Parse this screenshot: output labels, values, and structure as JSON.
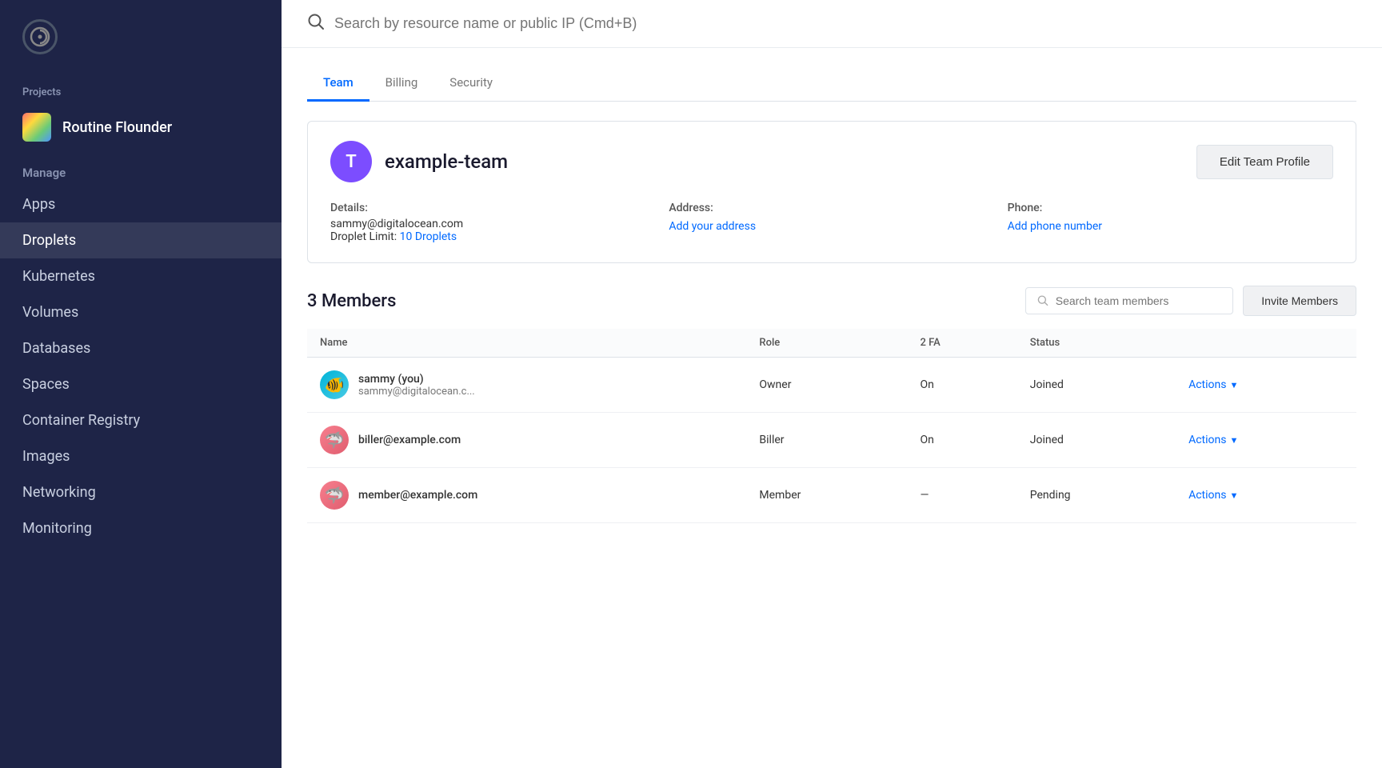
{
  "sidebar": {
    "logo_alt": "DigitalOcean",
    "projects_label": "Projects",
    "project_name": "Routine Flounder",
    "manage_label": "Manage",
    "items": [
      {
        "id": "apps",
        "label": "Apps"
      },
      {
        "id": "droplets",
        "label": "Droplets"
      },
      {
        "id": "kubernetes",
        "label": "Kubernetes"
      },
      {
        "id": "volumes",
        "label": "Volumes"
      },
      {
        "id": "databases",
        "label": "Databases"
      },
      {
        "id": "spaces",
        "label": "Spaces"
      },
      {
        "id": "container-registry",
        "label": "Container Registry"
      },
      {
        "id": "images",
        "label": "Images"
      },
      {
        "id": "networking",
        "label": "Networking"
      },
      {
        "id": "monitoring",
        "label": "Monitoring"
      }
    ]
  },
  "search": {
    "placeholder": "Search by resource name or public IP (Cmd+B)"
  },
  "tabs": [
    {
      "id": "team",
      "label": "Team",
      "active": true
    },
    {
      "id": "billing",
      "label": "Billing",
      "active": false
    },
    {
      "id": "security",
      "label": "Security",
      "active": false
    }
  ],
  "team_profile": {
    "avatar_letter": "T",
    "team_name": "example-team",
    "edit_button_label": "Edit Team Profile",
    "details_label": "Details:",
    "details_email": "sammy@digitalocean.com",
    "droplet_limit_text": "Droplet Limit:",
    "droplet_limit_value": "10 Droplets",
    "address_label": "Address:",
    "add_address_link": "Add your address",
    "phone_label": "Phone:",
    "add_phone_link": "Add phone number"
  },
  "members": {
    "count_label": "3 Members",
    "search_placeholder": "Search team members",
    "invite_button_label": "Invite Members",
    "table_headers": {
      "name": "Name",
      "role": "Role",
      "two_fa": "2 FA",
      "status": "Status"
    },
    "rows": [
      {
        "name": "sammy (you)",
        "email": "sammy@digitalocean.c...",
        "role": "Owner",
        "two_fa": "On",
        "status": "Joined",
        "avatar_emoji": "🐠",
        "avatar_class": "avatar-teal"
      },
      {
        "name": "biller@example.com",
        "email": "",
        "role": "Biller",
        "two_fa": "On",
        "status": "Joined",
        "avatar_emoji": "🦈",
        "avatar_class": "avatar-pink"
      },
      {
        "name": "member@example.com",
        "email": "",
        "role": "Member",
        "two_fa": "—",
        "status": "Pending",
        "avatar_emoji": "🦈",
        "avatar_class": "avatar-pink2"
      }
    ],
    "actions_label": "Actions"
  }
}
